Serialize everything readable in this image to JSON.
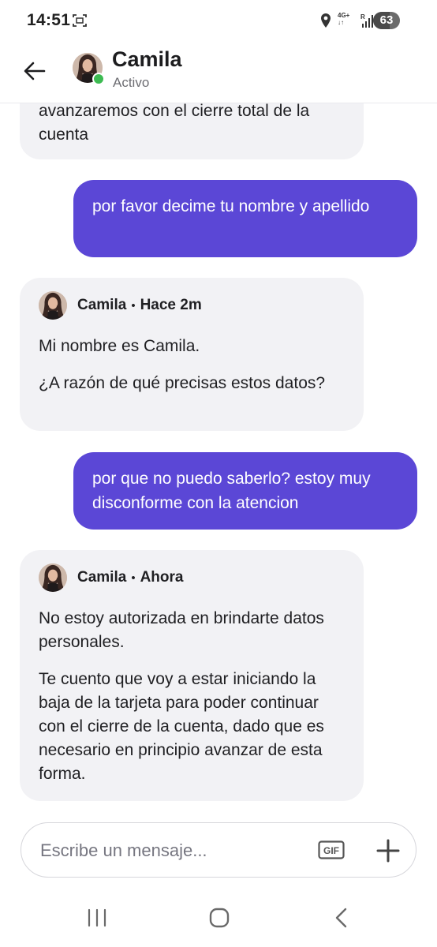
{
  "status_bar": {
    "time": "14:51",
    "network": "4G+",
    "roaming": "R",
    "battery": "63",
    "battery_level": 0.63
  },
  "header": {
    "contact_name": "Camila",
    "contact_status": "Activo",
    "icons": [
      "back-arrow-icon",
      "avatar",
      "online-indicator"
    ]
  },
  "messages": [
    {
      "direction": "incoming",
      "text": "avanzaremos con el cierre total de la cuenta"
    },
    {
      "direction": "outgoing",
      "text": "por favor decime tu nombre y apellido"
    },
    {
      "direction": "incoming",
      "sender": "Camila",
      "separator": "•",
      "time": "Hace 2m",
      "paragraphs": [
        "Mi nombre es Camila.",
        "¿A razón de qué precisas estos datos?"
      ]
    },
    {
      "direction": "outgoing",
      "text": "por que no puedo saberlo? estoy muy disconforme con la atencion"
    },
    {
      "direction": "incoming",
      "sender": "Camila",
      "separator": "•",
      "time": "Ahora",
      "paragraphs": [
        "No estoy autorizada en brindarte datos personales.",
        "Te cuento que voy a estar iniciando la baja de la tarjeta para poder continuar con el cierre de la cuenta, dado que es necesario en principio avanzar de esta forma."
      ]
    }
  ],
  "composer": {
    "placeholder": "Escribe un mensaje...",
    "gif_label": "GIF",
    "icons": [
      "gif-icon",
      "plus-icon"
    ]
  },
  "colors": {
    "outgoing_bubble": "#5b47d6",
    "incoming_bubble": "#f2f2f5",
    "online": "#3dbb52"
  }
}
